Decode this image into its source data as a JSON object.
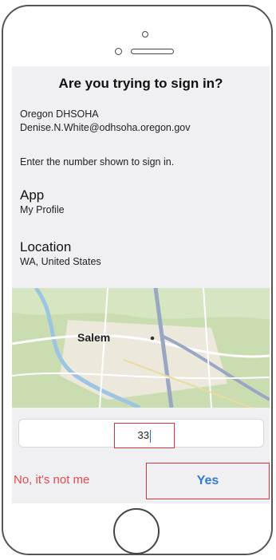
{
  "header": {
    "title": "Are you trying to sign in?"
  },
  "account": {
    "organization": "Oregon DHSOHA",
    "email": "Denise.N.White@odhsoha.oregon.gov"
  },
  "instruction": "Enter the number shown to sign in.",
  "app": {
    "label": "App",
    "value": "My Profile"
  },
  "location": {
    "label": "Location",
    "value": "WA, United States"
  },
  "map": {
    "city_label": "Salem"
  },
  "number_entry": {
    "value": "33"
  },
  "actions": {
    "deny_label": "No, it's not me",
    "approve_label": "Yes"
  },
  "colors": {
    "approve": "#2e7bd6",
    "deny": "#e14b4b",
    "highlight": "#d9343c"
  }
}
